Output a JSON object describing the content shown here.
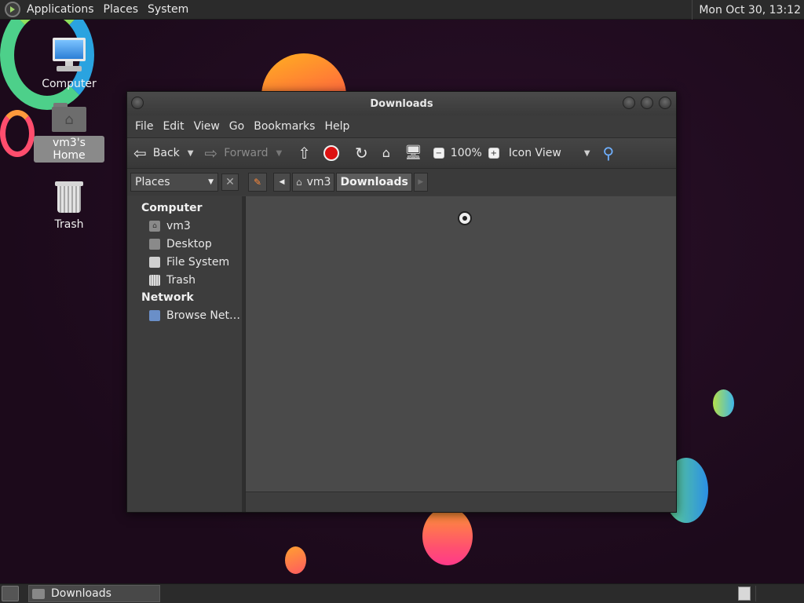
{
  "top_panel": {
    "menus": [
      "Applications",
      "Places",
      "System"
    ],
    "clock": "Mon Oct 30, 13:12"
  },
  "desktop_icons": {
    "computer": "Computer",
    "home": "vm3's Home",
    "trash": "Trash"
  },
  "window": {
    "title": "Downloads",
    "menu": [
      "File",
      "Edit",
      "View",
      "Go",
      "Bookmarks",
      "Help"
    ],
    "toolbar": {
      "back": "Back",
      "forward": "Forward",
      "zoom": "100%",
      "view_mode": "Icon View"
    },
    "location": {
      "places_label": "Places",
      "crumbs": [
        "vm3",
        "Downloads"
      ]
    },
    "sidebar": {
      "computer_heading": "Computer",
      "computer_items": [
        "vm3",
        "Desktop",
        "File System",
        "Trash"
      ],
      "network_heading": "Network",
      "network_items": [
        "Browse Net…"
      ]
    }
  },
  "taskbar": {
    "tasks": [
      "Downloads"
    ]
  }
}
